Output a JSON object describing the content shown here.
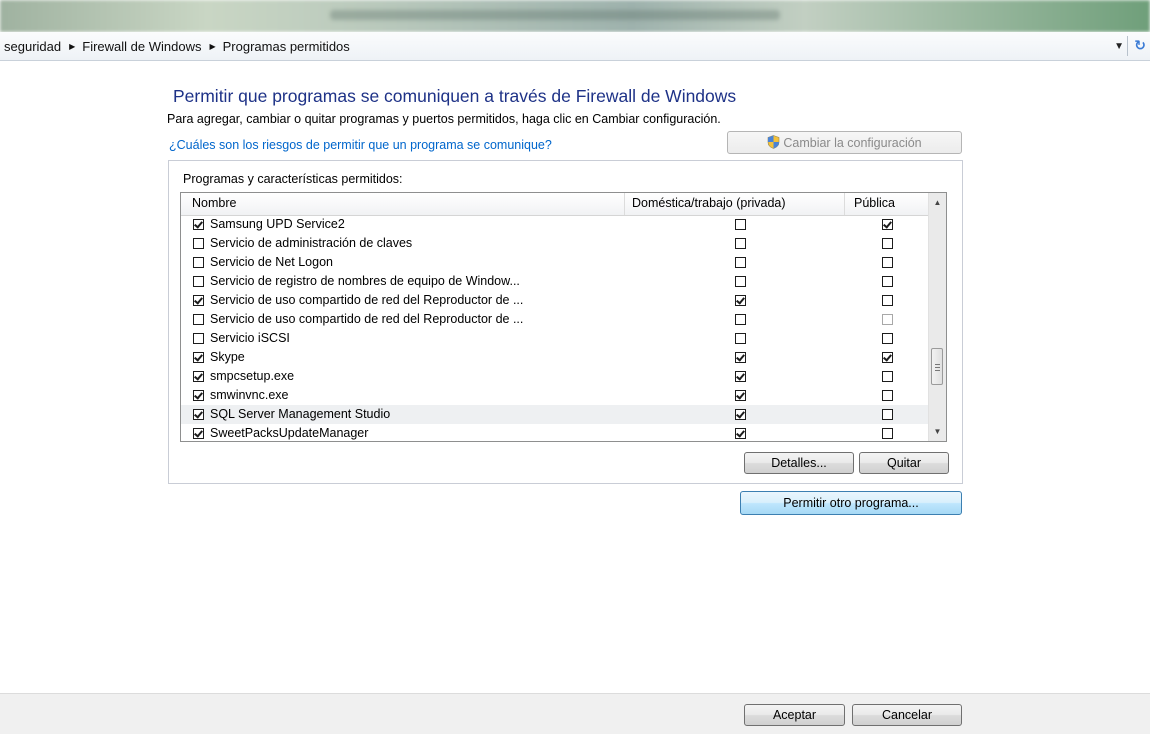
{
  "address_bar": {
    "crumbs": [
      "seguridad",
      "Firewall de Windows",
      "Programas permitidos"
    ],
    "separator": "▶",
    "dropdown_icon": "chevron-down-icon",
    "refresh_icon": "refresh-icon",
    "refresh_glyph": "↻",
    "dropdown_glyph": "▼"
  },
  "page": {
    "heading": "Permitir que programas se comuniquen a través de Firewall de Windows",
    "intro": "Para agregar, cambiar o quitar programas y puertos permitidos, haga clic en Cambiar configuración.",
    "risk_link": "¿Cuáles son los riesgos de permitir que un programa se comunique?",
    "change_settings_label": "Cambiar la configuración"
  },
  "programs": {
    "group_label": "Programas y características permitidos:",
    "columns": {
      "name": "Nombre",
      "home": "Doméstica/trabajo (privada)",
      "public": "Pública"
    },
    "rows": [
      {
        "name": "Samsung UPD Service2",
        "enabled": true,
        "home": false,
        "public": true
      },
      {
        "name": "Servicio de administración de claves",
        "enabled": false,
        "home": false,
        "public": false
      },
      {
        "name": "Servicio de Net Logon",
        "enabled": false,
        "home": false,
        "public": false
      },
      {
        "name": "Servicio de registro de nombres de equipo de Window...",
        "enabled": false,
        "home": false,
        "public": false
      },
      {
        "name": "Servicio de uso compartido de red del Reproductor de ...",
        "enabled": true,
        "home": true,
        "public": false
      },
      {
        "name": "Servicio de uso compartido de red del Reproductor de ...",
        "enabled": false,
        "home": false,
        "public": false
      },
      {
        "name": "Servicio iSCSI",
        "enabled": false,
        "home": false,
        "public": false
      },
      {
        "name": "Skype",
        "enabled": true,
        "home": true,
        "public": true
      },
      {
        "name": "smpcsetup.exe",
        "enabled": true,
        "home": true,
        "public": false
      },
      {
        "name": "smwinvnc.exe",
        "enabled": true,
        "home": true,
        "public": false
      },
      {
        "name": "SQL Server Management Studio",
        "enabled": true,
        "home": true,
        "public": false
      },
      {
        "name": "SweetPacksUpdateManager",
        "enabled": true,
        "home": true,
        "public": false
      }
    ],
    "details_label": "Detalles...",
    "remove_label": "Quitar"
  },
  "allow_other_label": "Permitir otro programa...",
  "footer": {
    "ok_label": "Aceptar",
    "cancel_label": "Cancelar"
  },
  "colors": {
    "heading": "#1e3287",
    "link": "#0066cc",
    "focused_button": "#d9ecfa"
  }
}
